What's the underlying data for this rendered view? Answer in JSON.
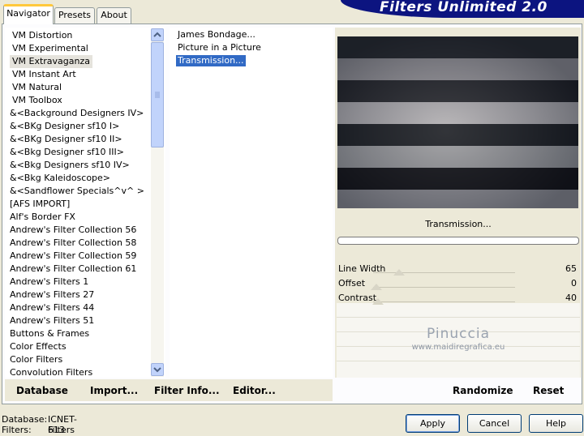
{
  "app": {
    "banner": "Filters Unlimited 2.0"
  },
  "tabs": [
    {
      "label": "Navigator",
      "active": true
    },
    {
      "label": "Presets",
      "active": false
    },
    {
      "label": "About",
      "active": false
    }
  ],
  "categories": [
    "VM Distortion",
    "VM Experimental",
    "VM Extravaganza",
    "VM Instant Art",
    "VM Natural",
    "VM Toolbox",
    "&<Background Designers IV>",
    "&<BKg Designer sf10 I>",
    "&<BKg Designer sf10 II>",
    "&<Bkg Designer sf10 III>",
    "&<Bkg Designers sf10 IV>",
    "&<Bkg Kaleidoscope>",
    "&<Sandflower Specials^v^ >",
    "[AFS IMPORT]",
    "Alf's Border FX",
    "Andrew's Filter Collection 56",
    "Andrew's Filter Collection 58",
    "Andrew's Filter Collection 59",
    "Andrew's Filter Collection 61",
    "Andrew's Filters 1",
    "Andrew's Filters 27",
    "Andrew's Filters 44",
    "Andrew's Filters 51",
    "Buttons & Frames",
    "Color Effects",
    "Color Filters",
    "Convolution Filters"
  ],
  "selected_category_index": 2,
  "filters": [
    {
      "label": "James Bondage...",
      "selected": false
    },
    {
      "label": "Picture in a Picture",
      "selected": false
    },
    {
      "label": "Transmission...",
      "selected": true
    }
  ],
  "left_actions": {
    "database": "Database",
    "import": "Import...",
    "filter_info": "Filter Info...",
    "editor": "Editor..."
  },
  "preview": {
    "filter_name": "Transmission...",
    "watermark_line1": "Pinuccia",
    "watermark_line2": "www.maidiregrafica.eu"
  },
  "params": [
    {
      "label": "Line Width",
      "value": "65"
    },
    {
      "label": "Offset",
      "value": "0"
    },
    {
      "label": "Contrast",
      "value": "40"
    }
  ],
  "right_actions": {
    "randomize": "Randomize",
    "reset": "Reset"
  },
  "status": {
    "database_label": "Database:",
    "database_value": "ICNET-Filters",
    "filters_label": "Filters:",
    "filters_value": "613"
  },
  "buttons": {
    "apply": "Apply",
    "cancel": "Cancel",
    "help": "Help"
  },
  "colors": {
    "banner": "#0c1480",
    "selection": "#316ac5",
    "tab_highlight": "#ffc83c"
  }
}
